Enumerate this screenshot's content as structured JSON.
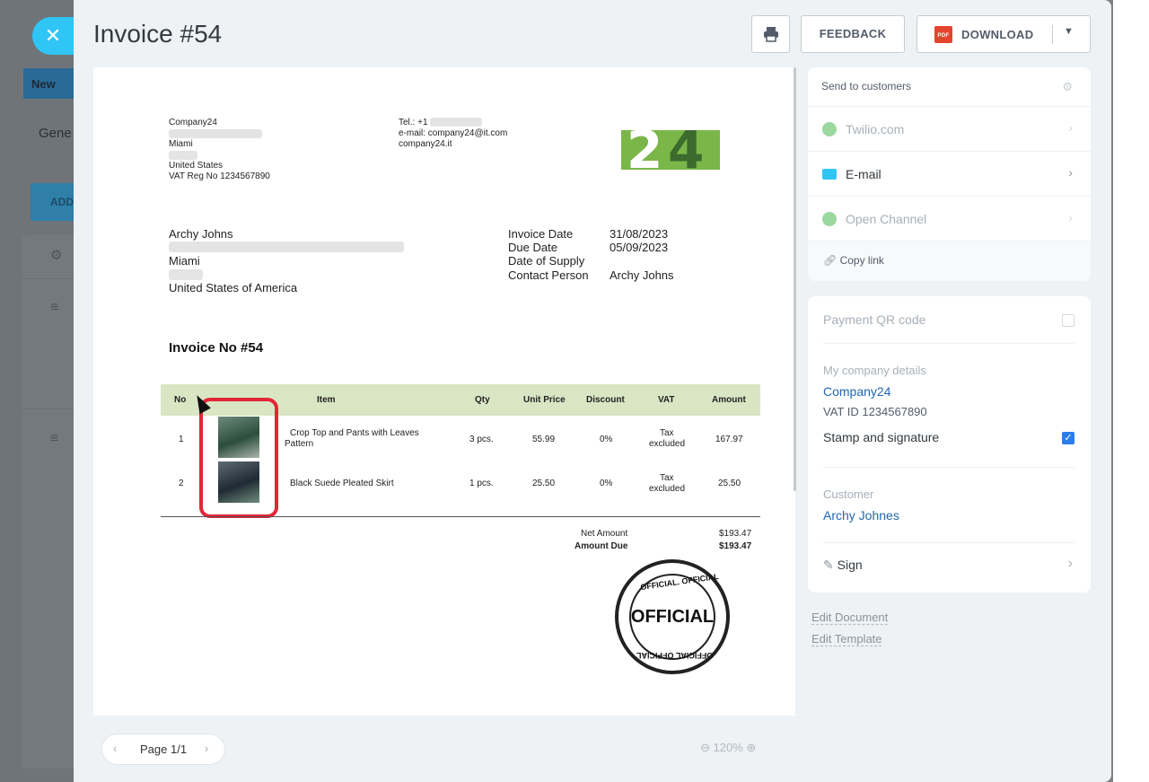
{
  "background": {
    "new_label": "New",
    "gene_label": "Gene",
    "add_label": "ADD"
  },
  "header": {
    "title": "Invoice #54",
    "feedback_label": "FEEDBACK",
    "download_label": "DOWNLOAD",
    "pdf_label": "PDF"
  },
  "invoice": {
    "company": {
      "name": "Company24",
      "city": "Miami",
      "country": "United States",
      "vat": "VAT Reg No 1234567890",
      "tel": "Tel.: +1",
      "email": "e-mail: company24@it.com",
      "site": "company24.it"
    },
    "logo": {
      "digit1": "2",
      "digit2": "4"
    },
    "client": {
      "name": "Archy Johns",
      "city": "Miami",
      "country": "United States of America"
    },
    "meta": [
      {
        "label": "Invoice Date",
        "value": "31/08/2023"
      },
      {
        "label": "Due Date",
        "value": "05/09/2023"
      },
      {
        "label": "Date of Supply",
        "value": ""
      },
      {
        "label": "Contact Person",
        "value": "Archy Johns"
      }
    ],
    "number_title": "Invoice No #54",
    "table": {
      "headers": [
        "No",
        "Item",
        "Qty",
        "Unit Price",
        "Discount",
        "VAT",
        "Amount"
      ],
      "rows": [
        {
          "no": "1",
          "item_line1": "Crop Top and Pants with Leaves",
          "item_line2": "Pattern",
          "qty": "3 pcs.",
          "price": "55.99",
          "discount": "0%",
          "vat_line1": "Tax",
          "vat_line2": "excluded",
          "amount": "167.97"
        },
        {
          "no": "2",
          "item_line1": "Black Suede Pleated Skirt",
          "item_line2": "",
          "qty": "1 pcs.",
          "price": "25.50",
          "discount": "0%",
          "vat_line1": "Tax",
          "vat_line2": "excluded",
          "amount": "25.50"
        }
      ]
    },
    "totals": [
      {
        "label": "Net Amount",
        "value": "$193.47"
      },
      {
        "label": "Amount Due",
        "value": "$193.47"
      }
    ],
    "stamp": {
      "center": "OFFICIAL",
      "top": "OFFICIAL. OFFICIAL",
      "bottom": "OFFICIAL OFFICIAL"
    }
  },
  "pager": {
    "label": "Page 1/1"
  },
  "zoom": {
    "label": "120%"
  },
  "send": {
    "header": "Send to customers",
    "channels": [
      {
        "label": "Twilio.com",
        "icon": "whatsapp-icon",
        "color": "#9ad8a0"
      },
      {
        "label": "E-mail",
        "icon": "envelope-icon",
        "color": "#2fc6f6"
      },
      {
        "label": "Open Channel",
        "icon": "chat-icon",
        "color": "#9ad8a0"
      }
    ],
    "copy_link": "Copy link"
  },
  "details": {
    "qr_label": "Payment QR code",
    "company_section": "My company details",
    "company_name": "Company24",
    "vat_id": "VAT ID 1234567890",
    "stamp_label": "Stamp and signature",
    "customer_section": "Customer",
    "customer_name": "Archy Johnes",
    "sign_label": "Sign"
  },
  "links": {
    "edit_document": "Edit Document",
    "edit_template": "Edit Template"
  },
  "colors": {
    "accent": "#2fc6f6",
    "link": "#2067b0",
    "checkbox": "#2b7de9",
    "highlight": "#e32636",
    "table_header": "#d9e6c4"
  }
}
